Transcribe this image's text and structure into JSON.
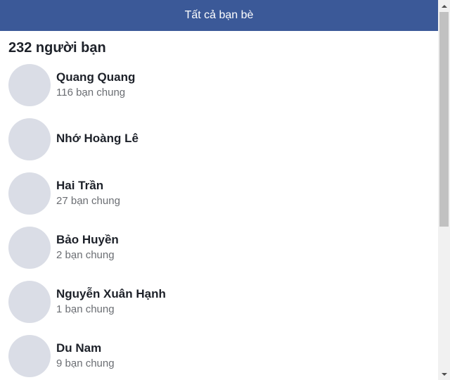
{
  "header": {
    "title": "Tất cả bạn bè"
  },
  "friends_section": {
    "count_title": "232 người bạn",
    "friends": [
      {
        "name": "Quang Quang",
        "mutual": "116 bạn chung"
      },
      {
        "name": "Nhớ Hoàng Lê",
        "mutual": ""
      },
      {
        "name": "Hai Trần",
        "mutual": "27 bạn chung"
      },
      {
        "name": "Bảo Huyền",
        "mutual": "2 bạn chung"
      },
      {
        "name": "Nguyễn Xuân Hạnh",
        "mutual": "1 bạn chung"
      },
      {
        "name": "Du Nam",
        "mutual": "9 bạn chung"
      }
    ]
  },
  "colors": {
    "header_bg": "#3b5998",
    "avatar_placeholder": "#dadde6",
    "name_text": "#1d2129",
    "secondary_text": "#6b6e73"
  }
}
